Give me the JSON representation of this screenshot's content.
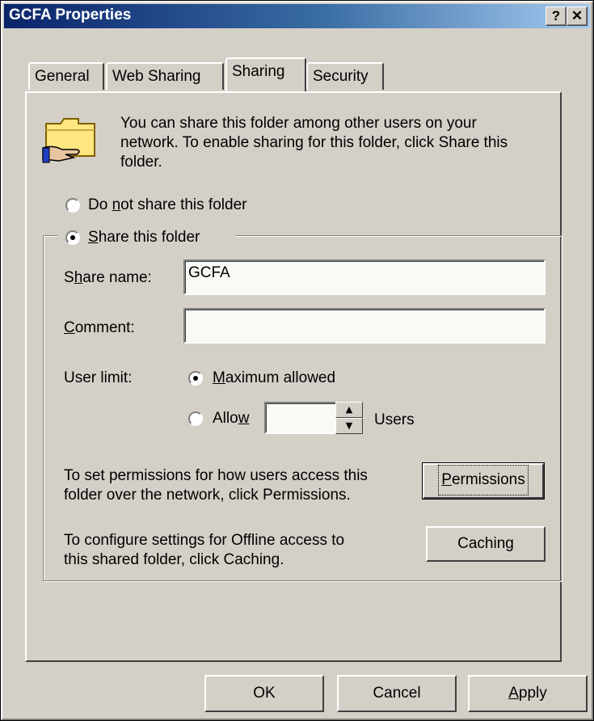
{
  "window": {
    "title": "GCFA Properties",
    "help_glyph": "?",
    "close_glyph": "✕"
  },
  "tabs": [
    {
      "label": "General"
    },
    {
      "label": "Web Sharing"
    },
    {
      "label": "Sharing"
    },
    {
      "label": "Security"
    }
  ],
  "sharing": {
    "description_line1": "You can share this folder among other users on your",
    "description_line2": "network.  To enable sharing for this folder, click Share this",
    "description_line3": "folder.",
    "option_not_share": {
      "pre": "Do ",
      "accel": "n",
      "post": "ot share this folder"
    },
    "option_share": {
      "pre": "",
      "accel": "S",
      "post": "hare this folder"
    },
    "share_name_label": {
      "pre": "S",
      "accel": "h",
      "post": "are name:"
    },
    "share_name_value": "GCFA",
    "comment_label": {
      "pre": "",
      "accel": "C",
      "post": "omment:"
    },
    "comment_value": "",
    "user_limit_label": "User limit:",
    "max_allowed": {
      "pre": "",
      "accel": "M",
      "post": "aximum allowed"
    },
    "allow": {
      "pre": "Allo",
      "accel": "w",
      "post": ""
    },
    "allow_value": "",
    "users_label": "Users",
    "permissions_text_line1": "To set permissions for how users access this",
    "permissions_text_line2": "folder over the network, click Permissions.",
    "permissions_button": {
      "pre": "",
      "accel": "P",
      "post": "ermissions"
    },
    "caching_text_line1": "To configure settings for Offline access to",
    "caching_text_line2": "this shared folder, click Caching.",
    "caching_button": "Caching"
  },
  "footer": {
    "ok": "OK",
    "cancel": "Cancel",
    "apply": {
      "pre": "",
      "accel": "A",
      "post": "pply"
    }
  }
}
